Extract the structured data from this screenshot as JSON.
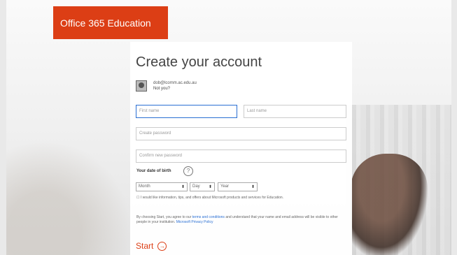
{
  "brand": {
    "label": "Office 365 Education",
    "color": "#dc3e15"
  },
  "form": {
    "title": "Create your account",
    "user": {
      "email": "dob@lcomm.ac.edu.au",
      "not_you": "Not you?"
    },
    "fields": {
      "first_name": {
        "placeholder": "First name"
      },
      "last_name": {
        "placeholder": "Last name"
      },
      "password": {
        "placeholder": "Create password"
      },
      "confirm_password": {
        "placeholder": "Confirm new password"
      }
    },
    "dob": {
      "label": "Your date of birth",
      "month": "Month",
      "day": "Day",
      "year": "Year"
    },
    "checkbox_text": "I would like information, tips, and offers about Microsoft products and services for Education.",
    "terms": {
      "prefix": "By choosing Start, you agree to our",
      "link1": "terms and conditions",
      "middle": "and understand that your name and email address will be visible to other people in your institution.",
      "link2": "Microsoft Privacy Policy"
    },
    "start_label": "Start"
  }
}
